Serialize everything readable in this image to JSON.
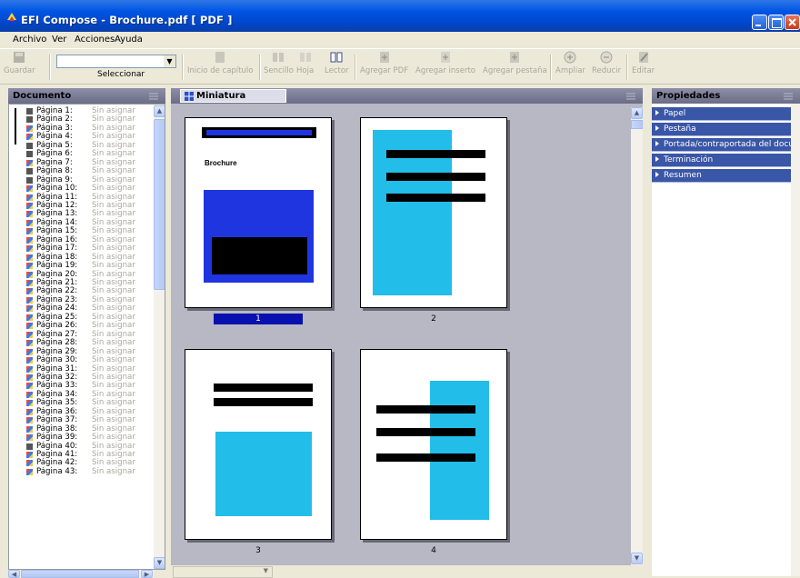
{
  "window": {
    "title": "EFI Compose - Brochure.pdf [ PDF ]"
  },
  "menu": [
    "Archivo",
    "Ver",
    "Acciones",
    "Ayuda"
  ],
  "toolbar": {
    "guardar": "Guardar",
    "seleccionar": "Seleccionar",
    "inicio_capitulo": "Inicio de capítulo",
    "sencillo": "Sencillo",
    "hoja": "Hoja",
    "lector": "Lector",
    "agregar_pdf": "Agregar PDF",
    "agregar_inserto": "Agregar inserto",
    "agregar_pestana": "Agregar pestaña",
    "ampliar": "Ampliar",
    "reducir": "Reducir",
    "editar": "Editar"
  },
  "document_panel": {
    "title": "Documento",
    "status": "Sin asignar",
    "pages": [
      {
        "label": "Página 1:",
        "color": "#555555"
      },
      {
        "label": "Página 2:",
        "color": "#555555"
      },
      {
        "label": "Página 3:",
        "color": "#7e4fcf"
      },
      {
        "label": "Página 4:",
        "color": "#7e4fcf"
      },
      {
        "label": "Página 5:",
        "color": "#555555"
      },
      {
        "label": "Página 6:",
        "color": "#555555"
      },
      {
        "label": "Pagina 7:",
        "color": "#7e4fcf"
      },
      {
        "label": "Página 8:",
        "color": "#555555"
      },
      {
        "label": "Página 9:",
        "color": "#555555"
      },
      {
        "label": "Página 10:",
        "color": "#7e4fcf"
      },
      {
        "label": "Página 11:",
        "color": "#7e4fcf"
      },
      {
        "label": "Página 12:",
        "color": "#7e4fcf"
      },
      {
        "label": "Página 13:",
        "color": "#7e4fcf"
      },
      {
        "label": "Página 14:",
        "color": "#7e4fcf"
      },
      {
        "label": "Página 15:",
        "color": "#7e4fcf"
      },
      {
        "label": "Página 16:",
        "color": "#7e4fcf"
      },
      {
        "label": "Página 17:",
        "color": "#7e4fcf"
      },
      {
        "label": "Página 18:",
        "color": "#7e4fcf"
      },
      {
        "label": "Página 19:",
        "color": "#7e4fcf"
      },
      {
        "label": "Pagina 20:",
        "color": "#7e4fcf"
      },
      {
        "label": "Página 21:",
        "color": "#7e4fcf"
      },
      {
        "label": "Página 22:",
        "color": "#7e4fcf"
      },
      {
        "label": "Página 23:",
        "color": "#7e4fcf"
      },
      {
        "label": "Página 24:",
        "color": "#7e4fcf"
      },
      {
        "label": "Página 25:",
        "color": "#7e4fcf"
      },
      {
        "label": "Página 26:",
        "color": "#7e4fcf"
      },
      {
        "label": "Página 27:",
        "color": "#7e4fcf"
      },
      {
        "label": "Página 28:",
        "color": "#7e4fcf"
      },
      {
        "label": "Página 29:",
        "color": "#7e4fcf"
      },
      {
        "label": "Página 30:",
        "color": "#7e4fcf"
      },
      {
        "label": "Página 31:",
        "color": "#7e4fcf"
      },
      {
        "label": "Página 32:",
        "color": "#7e4fcf"
      },
      {
        "label": "Página 33:",
        "color": "#7e4fcf"
      },
      {
        "label": "Página 34:",
        "color": "#7e4fcf"
      },
      {
        "label": "Página 35:",
        "color": "#7e4fcf"
      },
      {
        "label": "Página 36:",
        "color": "#7e4fcf"
      },
      {
        "label": "Página 37:",
        "color": "#7e4fcf"
      },
      {
        "label": "Página 38:",
        "color": "#7e4fcf"
      },
      {
        "label": "Página 39:",
        "color": "#7e4fcf"
      },
      {
        "label": "Página 40:",
        "color": "#555555"
      },
      {
        "label": "Pagina 41:",
        "color": "#7e4fcf"
      },
      {
        "label": "Página 42:",
        "color": "#7e4fcf"
      },
      {
        "label": "Página 43:",
        "color": "#7e4fcf"
      }
    ]
  },
  "thumbnail_panel": {
    "title": "Miniatura",
    "pages": [
      {
        "label": "1",
        "selected": true,
        "heading": "Brochure"
      },
      {
        "label": "2",
        "selected": false
      },
      {
        "label": "3",
        "selected": false
      },
      {
        "label": "4",
        "selected": false
      }
    ]
  },
  "properties_panel": {
    "title": "Propiedades",
    "items": [
      "Papel",
      "Pestaña",
      "Portada/contraportada del documento",
      "Terminación",
      "Resumen"
    ]
  },
  "colors": {
    "accent_blue": "#1f35e0",
    "cyan": "#22bde8",
    "selected_label": "#0a0fb0"
  }
}
